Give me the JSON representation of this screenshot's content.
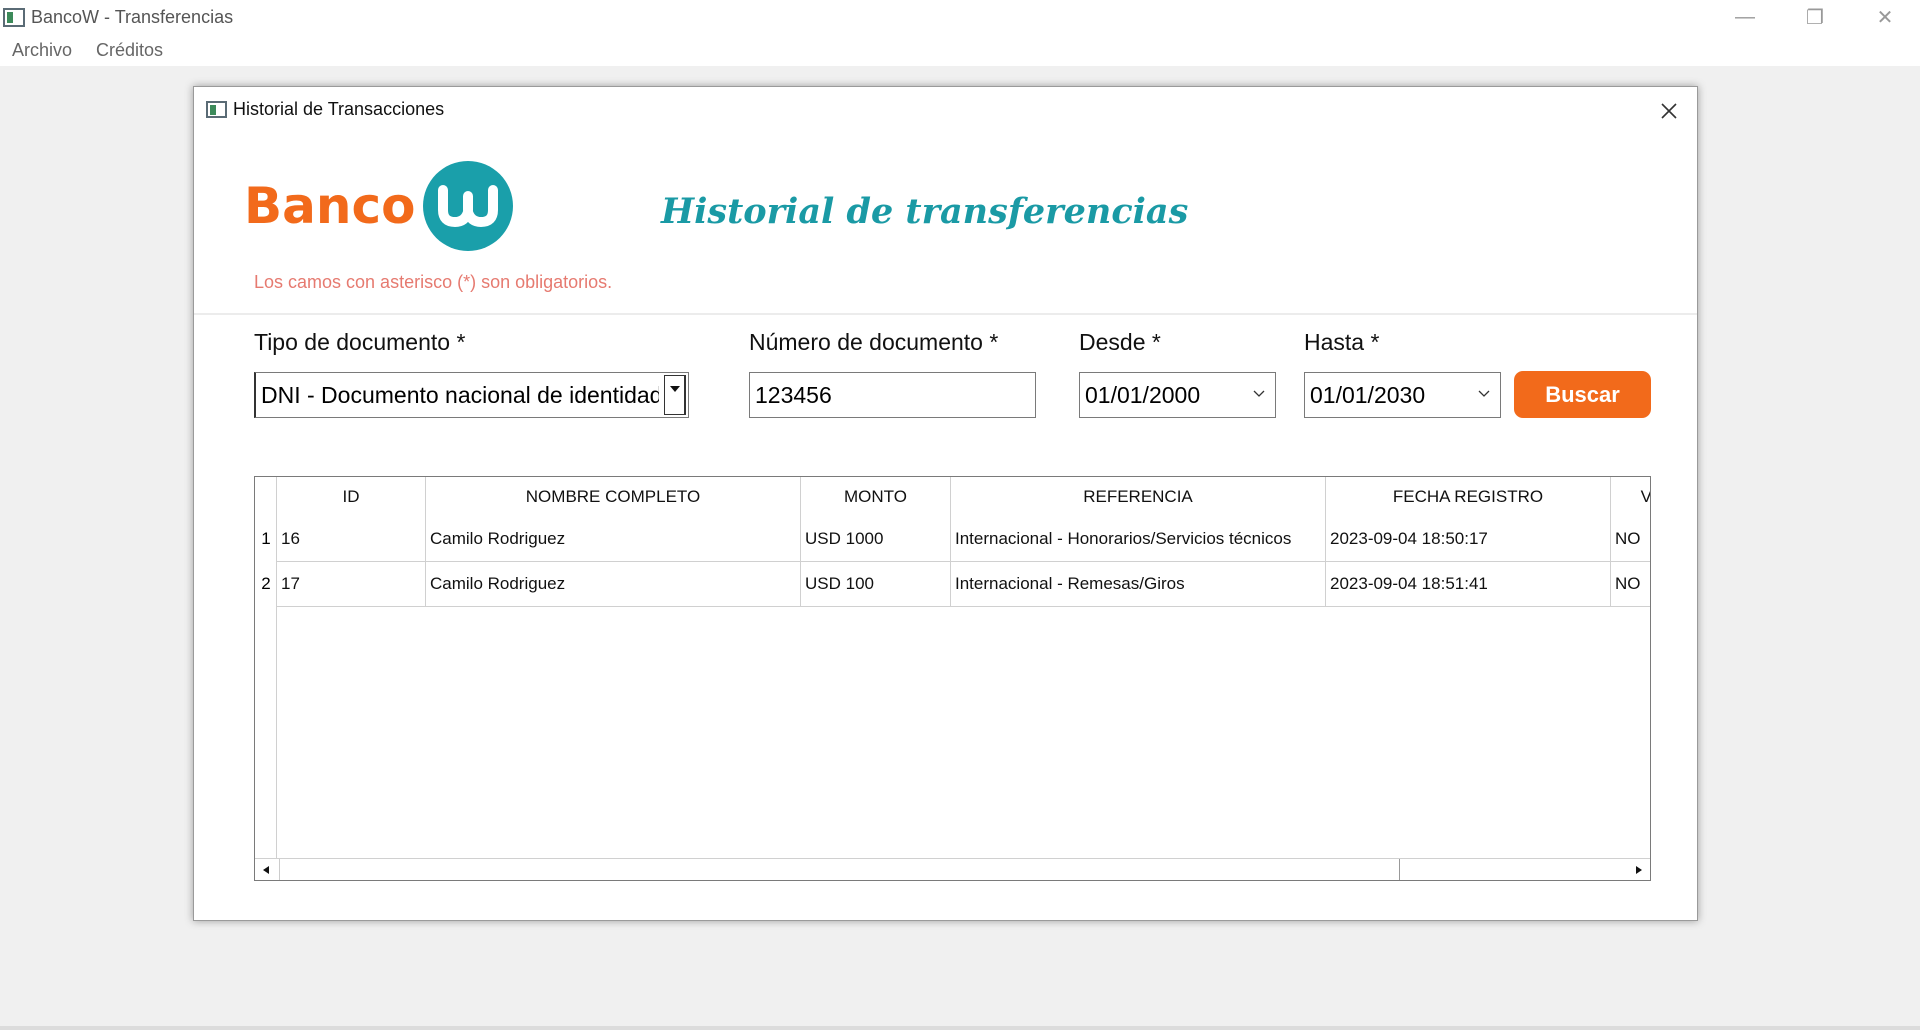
{
  "window": {
    "title": "BancoW - Transferencias",
    "controls": {
      "minimize": "—",
      "restore": "❐",
      "close": "✕"
    }
  },
  "menu": [
    "Archivo",
    "Créditos"
  ],
  "dialog": {
    "title": "Historial de Transacciones",
    "logo_text": "Banco",
    "heading": "Historial de transferencias",
    "required_note": "Los camos con asterisco (*) son obligatorios.",
    "form": {
      "tipo_label": "Tipo de documento *",
      "tipo_value": "DNI - Documento nacional de identidad",
      "numero_label": "Número de documento *",
      "numero_value": "123456",
      "desde_label": "Desde *",
      "desde_value": "01/01/2000",
      "hasta_label": "Hasta *",
      "hasta_value": "01/01/2030",
      "buscar_label": "Buscar"
    },
    "table": {
      "columns": [
        "ID",
        "NOMBRE COMPLETO",
        "MONTO",
        "REFERENCIA",
        "FECHA REGISTRO",
        "V"
      ],
      "rows": [
        {
          "num": "1",
          "id": "16",
          "nombre": "Camilo  Rodriguez",
          "monto": "USD 1000",
          "referencia": "Internacional - Honorarios/Servicios técnicos",
          "fecha": "2023-09-04 18:50:17",
          "v": "NO"
        },
        {
          "num": "2",
          "id": "17",
          "nombre": "Camilo  Rodriguez",
          "monto": "USD 100",
          "referencia": "Internacional - Remesas/Giros",
          "fecha": "2023-09-04 18:51:41",
          "v": "NO"
        }
      ]
    }
  },
  "colors": {
    "brand_orange": "#f26a1b",
    "brand_teal": "#1a9faa",
    "note_red": "#e67a70"
  }
}
